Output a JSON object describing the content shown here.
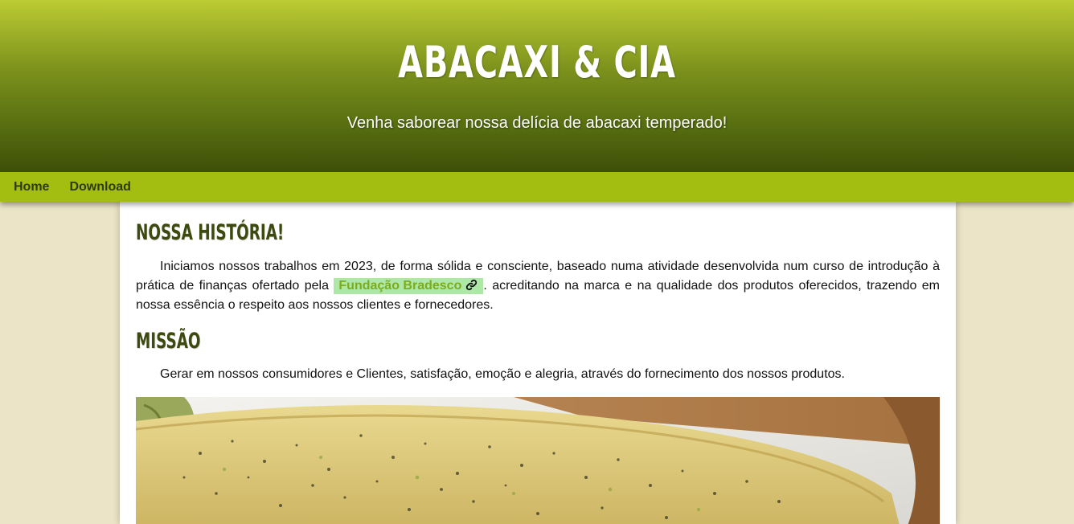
{
  "header": {
    "title": "ABACAXI & CIA",
    "subtitle": "Venha saborear nossa delícia de abacaxi temperado!"
  },
  "nav": {
    "items": [
      {
        "label": "Home"
      },
      {
        "label": "Download"
      }
    ]
  },
  "main": {
    "history": {
      "title": "NOSSA HISTÓRIA!",
      "text_before": "Iniciamos nossos trabalhos em 2023, de forma sólida e consciente, baseado numa atividade desenvolvida num curso de introdução à prática de finanças ofertado pela ",
      "link_label": "Fundação Bradesco",
      "link_icon": "link-icon",
      "text_after": ". acreditando na marca e na qualidade dos produtos oferecidos, trazendo em nossa essência o respeito aos nossos clientes e fornecedores."
    },
    "mission": {
      "title": "MISSÃO",
      "text": "Gerar em nossos consumidores e Clientes, satisfação, emoção e alegria, através do fornecimento dos nossos produtos."
    },
    "photo": {
      "subject": "seasoned-pineapple-photo"
    }
  },
  "colors": {
    "header_top": "#bccc34",
    "header_bottom": "#3e4f09",
    "nav_bg": "#a3bd10",
    "page_bg": "#ebe4c6",
    "heading": "#3c4a10",
    "link_bg": "#aee8a6",
    "link_text": "#7cab1c"
  }
}
